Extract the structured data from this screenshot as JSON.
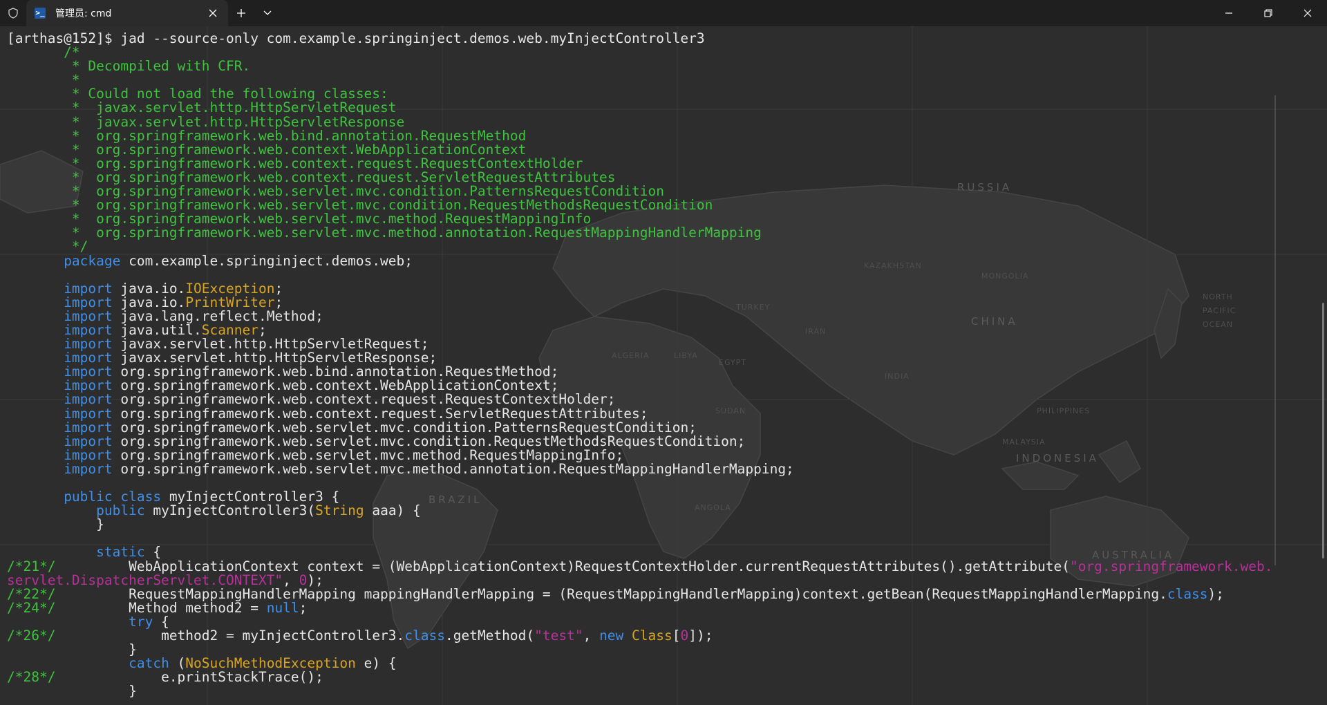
{
  "window": {
    "tab_title": "管理员: cmd",
    "tab_icon": "powershell-icon",
    "buttons": [
      "minimize-icon",
      "restore-icon",
      "close-icon"
    ]
  },
  "map_labels": [
    "RUSSIA",
    "CHINA",
    "KAZAKHSTAN",
    "MONGOLIA",
    "INDIA",
    "INDONESIA",
    "ALGERIA",
    "EGYPT",
    "LIBYA",
    "SUDAN",
    "BRAZIL",
    "AUSTRALIA",
    "TURKEY",
    "IRAN",
    "PHILIPPINES",
    "MALAYSIA",
    "ANGOLA",
    "NORTH PACIFIC OCEAN"
  ],
  "terminal": {
    "lines": [
      [
        {
          "t": "[arthas@152]$ jad --source-only com.example.springinject.demos.web.myInjectController3",
          "c": ""
        }
      ],
      [
        {
          "t": "       /*",
          "c": "c"
        }
      ],
      [
        {
          "t": "        * Decompiled with CFR.",
          "c": "c"
        }
      ],
      [
        {
          "t": "        *",
          "c": "c"
        }
      ],
      [
        {
          "t": "        * Could not load the following classes:",
          "c": "c"
        }
      ],
      [
        {
          "t": "        *  javax.servlet.http.HttpServletRequest",
          "c": "c"
        }
      ],
      [
        {
          "t": "        *  javax.servlet.http.HttpServletResponse",
          "c": "c"
        }
      ],
      [
        {
          "t": "        *  org.springframework.web.bind.annotation.RequestMethod",
          "c": "c"
        }
      ],
      [
        {
          "t": "        *  org.springframework.web.context.WebApplicationContext",
          "c": "c"
        }
      ],
      [
        {
          "t": "        *  org.springframework.web.context.request.RequestContextHolder",
          "c": "c"
        }
      ],
      [
        {
          "t": "        *  org.springframework.web.context.request.ServletRequestAttributes",
          "c": "c"
        }
      ],
      [
        {
          "t": "        *  org.springframework.web.servlet.mvc.condition.PatternsRequestCondition",
          "c": "c"
        }
      ],
      [
        {
          "t": "        *  org.springframework.web.servlet.mvc.condition.RequestMethodsRequestCondition",
          "c": "c"
        }
      ],
      [
        {
          "t": "        *  org.springframework.web.servlet.mvc.method.RequestMappingInfo",
          "c": "c"
        }
      ],
      [
        {
          "t": "        *  org.springframework.web.servlet.mvc.method.annotation.RequestMappingHandlerMapping",
          "c": "c"
        }
      ],
      [
        {
          "t": "        */",
          "c": "c"
        }
      ],
      [
        {
          "t": "       ",
          "c": ""
        },
        {
          "t": "package",
          "c": "k"
        },
        {
          "t": " com.example.springinject.demos.web;",
          "c": ""
        }
      ],
      [
        {
          "t": "",
          "c": ""
        }
      ],
      [
        {
          "t": "       ",
          "c": ""
        },
        {
          "t": "import",
          "c": "k"
        },
        {
          "t": " java.io.",
          "c": ""
        },
        {
          "t": "IOException",
          "c": "y"
        },
        {
          "t": ";",
          "c": ""
        }
      ],
      [
        {
          "t": "       ",
          "c": ""
        },
        {
          "t": "import",
          "c": "k"
        },
        {
          "t": " java.io.",
          "c": ""
        },
        {
          "t": "PrintWriter",
          "c": "y"
        },
        {
          "t": ";",
          "c": ""
        }
      ],
      [
        {
          "t": "       ",
          "c": ""
        },
        {
          "t": "import",
          "c": "k"
        },
        {
          "t": " java.lang.reflect.Method;",
          "c": ""
        }
      ],
      [
        {
          "t": "       ",
          "c": ""
        },
        {
          "t": "import",
          "c": "k"
        },
        {
          "t": " java.util.",
          "c": ""
        },
        {
          "t": "Scanner",
          "c": "y"
        },
        {
          "t": ";",
          "c": ""
        }
      ],
      [
        {
          "t": "       ",
          "c": ""
        },
        {
          "t": "import",
          "c": "k"
        },
        {
          "t": " javax.servlet.http.HttpServletRequest;",
          "c": ""
        }
      ],
      [
        {
          "t": "       ",
          "c": ""
        },
        {
          "t": "import",
          "c": "k"
        },
        {
          "t": " javax.servlet.http.HttpServletResponse;",
          "c": ""
        }
      ],
      [
        {
          "t": "       ",
          "c": ""
        },
        {
          "t": "import",
          "c": "k"
        },
        {
          "t": " org.springframework.web.bind.annotation.RequestMethod;",
          "c": ""
        }
      ],
      [
        {
          "t": "       ",
          "c": ""
        },
        {
          "t": "import",
          "c": "k"
        },
        {
          "t": " org.springframework.web.context.WebApplicationContext;",
          "c": ""
        }
      ],
      [
        {
          "t": "       ",
          "c": ""
        },
        {
          "t": "import",
          "c": "k"
        },
        {
          "t": " org.springframework.web.context.request.RequestContextHolder;",
          "c": ""
        }
      ],
      [
        {
          "t": "       ",
          "c": ""
        },
        {
          "t": "import",
          "c": "k"
        },
        {
          "t": " org.springframework.web.context.request.ServletRequestAttributes;",
          "c": ""
        }
      ],
      [
        {
          "t": "       ",
          "c": ""
        },
        {
          "t": "import",
          "c": "k"
        },
        {
          "t": " org.springframework.web.servlet.mvc.condition.PatternsRequestCondition;",
          "c": ""
        }
      ],
      [
        {
          "t": "       ",
          "c": ""
        },
        {
          "t": "import",
          "c": "k"
        },
        {
          "t": " org.springframework.web.servlet.mvc.condition.RequestMethodsRequestCondition;",
          "c": ""
        }
      ],
      [
        {
          "t": "       ",
          "c": ""
        },
        {
          "t": "import",
          "c": "k"
        },
        {
          "t": " org.springframework.web.servlet.mvc.method.RequestMappingInfo;",
          "c": ""
        }
      ],
      [
        {
          "t": "       ",
          "c": ""
        },
        {
          "t": "import",
          "c": "k"
        },
        {
          "t": " org.springframework.web.servlet.mvc.method.annotation.RequestMappingHandlerMapping;",
          "c": ""
        }
      ],
      [
        {
          "t": "",
          "c": ""
        }
      ],
      [
        {
          "t": "       ",
          "c": ""
        },
        {
          "t": "public class",
          "c": "k"
        },
        {
          "t": " myInjectController3 {",
          "c": ""
        }
      ],
      [
        {
          "t": "           ",
          "c": ""
        },
        {
          "t": "public",
          "c": "k"
        },
        {
          "t": " myInjectController3(",
          "c": ""
        },
        {
          "t": "String",
          "c": "y"
        },
        {
          "t": " aaa) {",
          "c": ""
        }
      ],
      [
        {
          "t": "           }",
          "c": ""
        }
      ],
      [
        {
          "t": "",
          "c": ""
        }
      ],
      [
        {
          "t": "           ",
          "c": ""
        },
        {
          "t": "static",
          "c": "k"
        },
        {
          "t": " {",
          "c": ""
        }
      ],
      [
        {
          "t": "/*21*/",
          "c": "g"
        },
        {
          "t": "         WebApplicationContext context = (WebApplicationContext)RequestContextHolder.currentRequestAttributes().getAttribute(",
          "c": ""
        },
        {
          "t": "\"org.springframework.web.",
          "c": "s"
        }
      ],
      [
        {
          "t": "servlet.DispatcherServlet.CONTEXT\"",
          "c": "s"
        },
        {
          "t": ", ",
          "c": ""
        },
        {
          "t": "0",
          "c": "s"
        },
        {
          "t": ");",
          "c": ""
        }
      ],
      [
        {
          "t": "/*22*/",
          "c": "g"
        },
        {
          "t": "         RequestMappingHandlerMapping mappingHandlerMapping = (RequestMappingHandlerMapping)context.getBean(RequestMappingHandlerMapping.",
          "c": ""
        },
        {
          "t": "class",
          "c": "k"
        },
        {
          "t": ");",
          "c": ""
        }
      ],
      [
        {
          "t": "/*24*/",
          "c": "g"
        },
        {
          "t": "         Method method2 = ",
          "c": ""
        },
        {
          "t": "null",
          "c": "k"
        },
        {
          "t": ";",
          "c": ""
        }
      ],
      [
        {
          "t": "               ",
          "c": ""
        },
        {
          "t": "try",
          "c": "k"
        },
        {
          "t": " {",
          "c": ""
        }
      ],
      [
        {
          "t": "/*26*/",
          "c": "g"
        },
        {
          "t": "             method2 = myInjectController3.",
          "c": ""
        },
        {
          "t": "class",
          "c": "k"
        },
        {
          "t": ".getMethod(",
          "c": ""
        },
        {
          "t": "\"test\"",
          "c": "s"
        },
        {
          "t": ", ",
          "c": ""
        },
        {
          "t": "new",
          "c": "k"
        },
        {
          "t": " ",
          "c": ""
        },
        {
          "t": "Class",
          "c": "y"
        },
        {
          "t": "[",
          "c": ""
        },
        {
          "t": "0",
          "c": "s"
        },
        {
          "t": "]);",
          "c": ""
        }
      ],
      [
        {
          "t": "               }",
          "c": ""
        }
      ],
      [
        {
          "t": "               ",
          "c": ""
        },
        {
          "t": "catch",
          "c": "k"
        },
        {
          "t": " (",
          "c": ""
        },
        {
          "t": "NoSuchMethodException",
          "c": "y"
        },
        {
          "t": " e) {",
          "c": ""
        }
      ],
      [
        {
          "t": "/*28*/",
          "c": "g"
        },
        {
          "t": "             e.printStackTrace();",
          "c": ""
        }
      ],
      [
        {
          "t": "               }",
          "c": ""
        }
      ]
    ]
  }
}
